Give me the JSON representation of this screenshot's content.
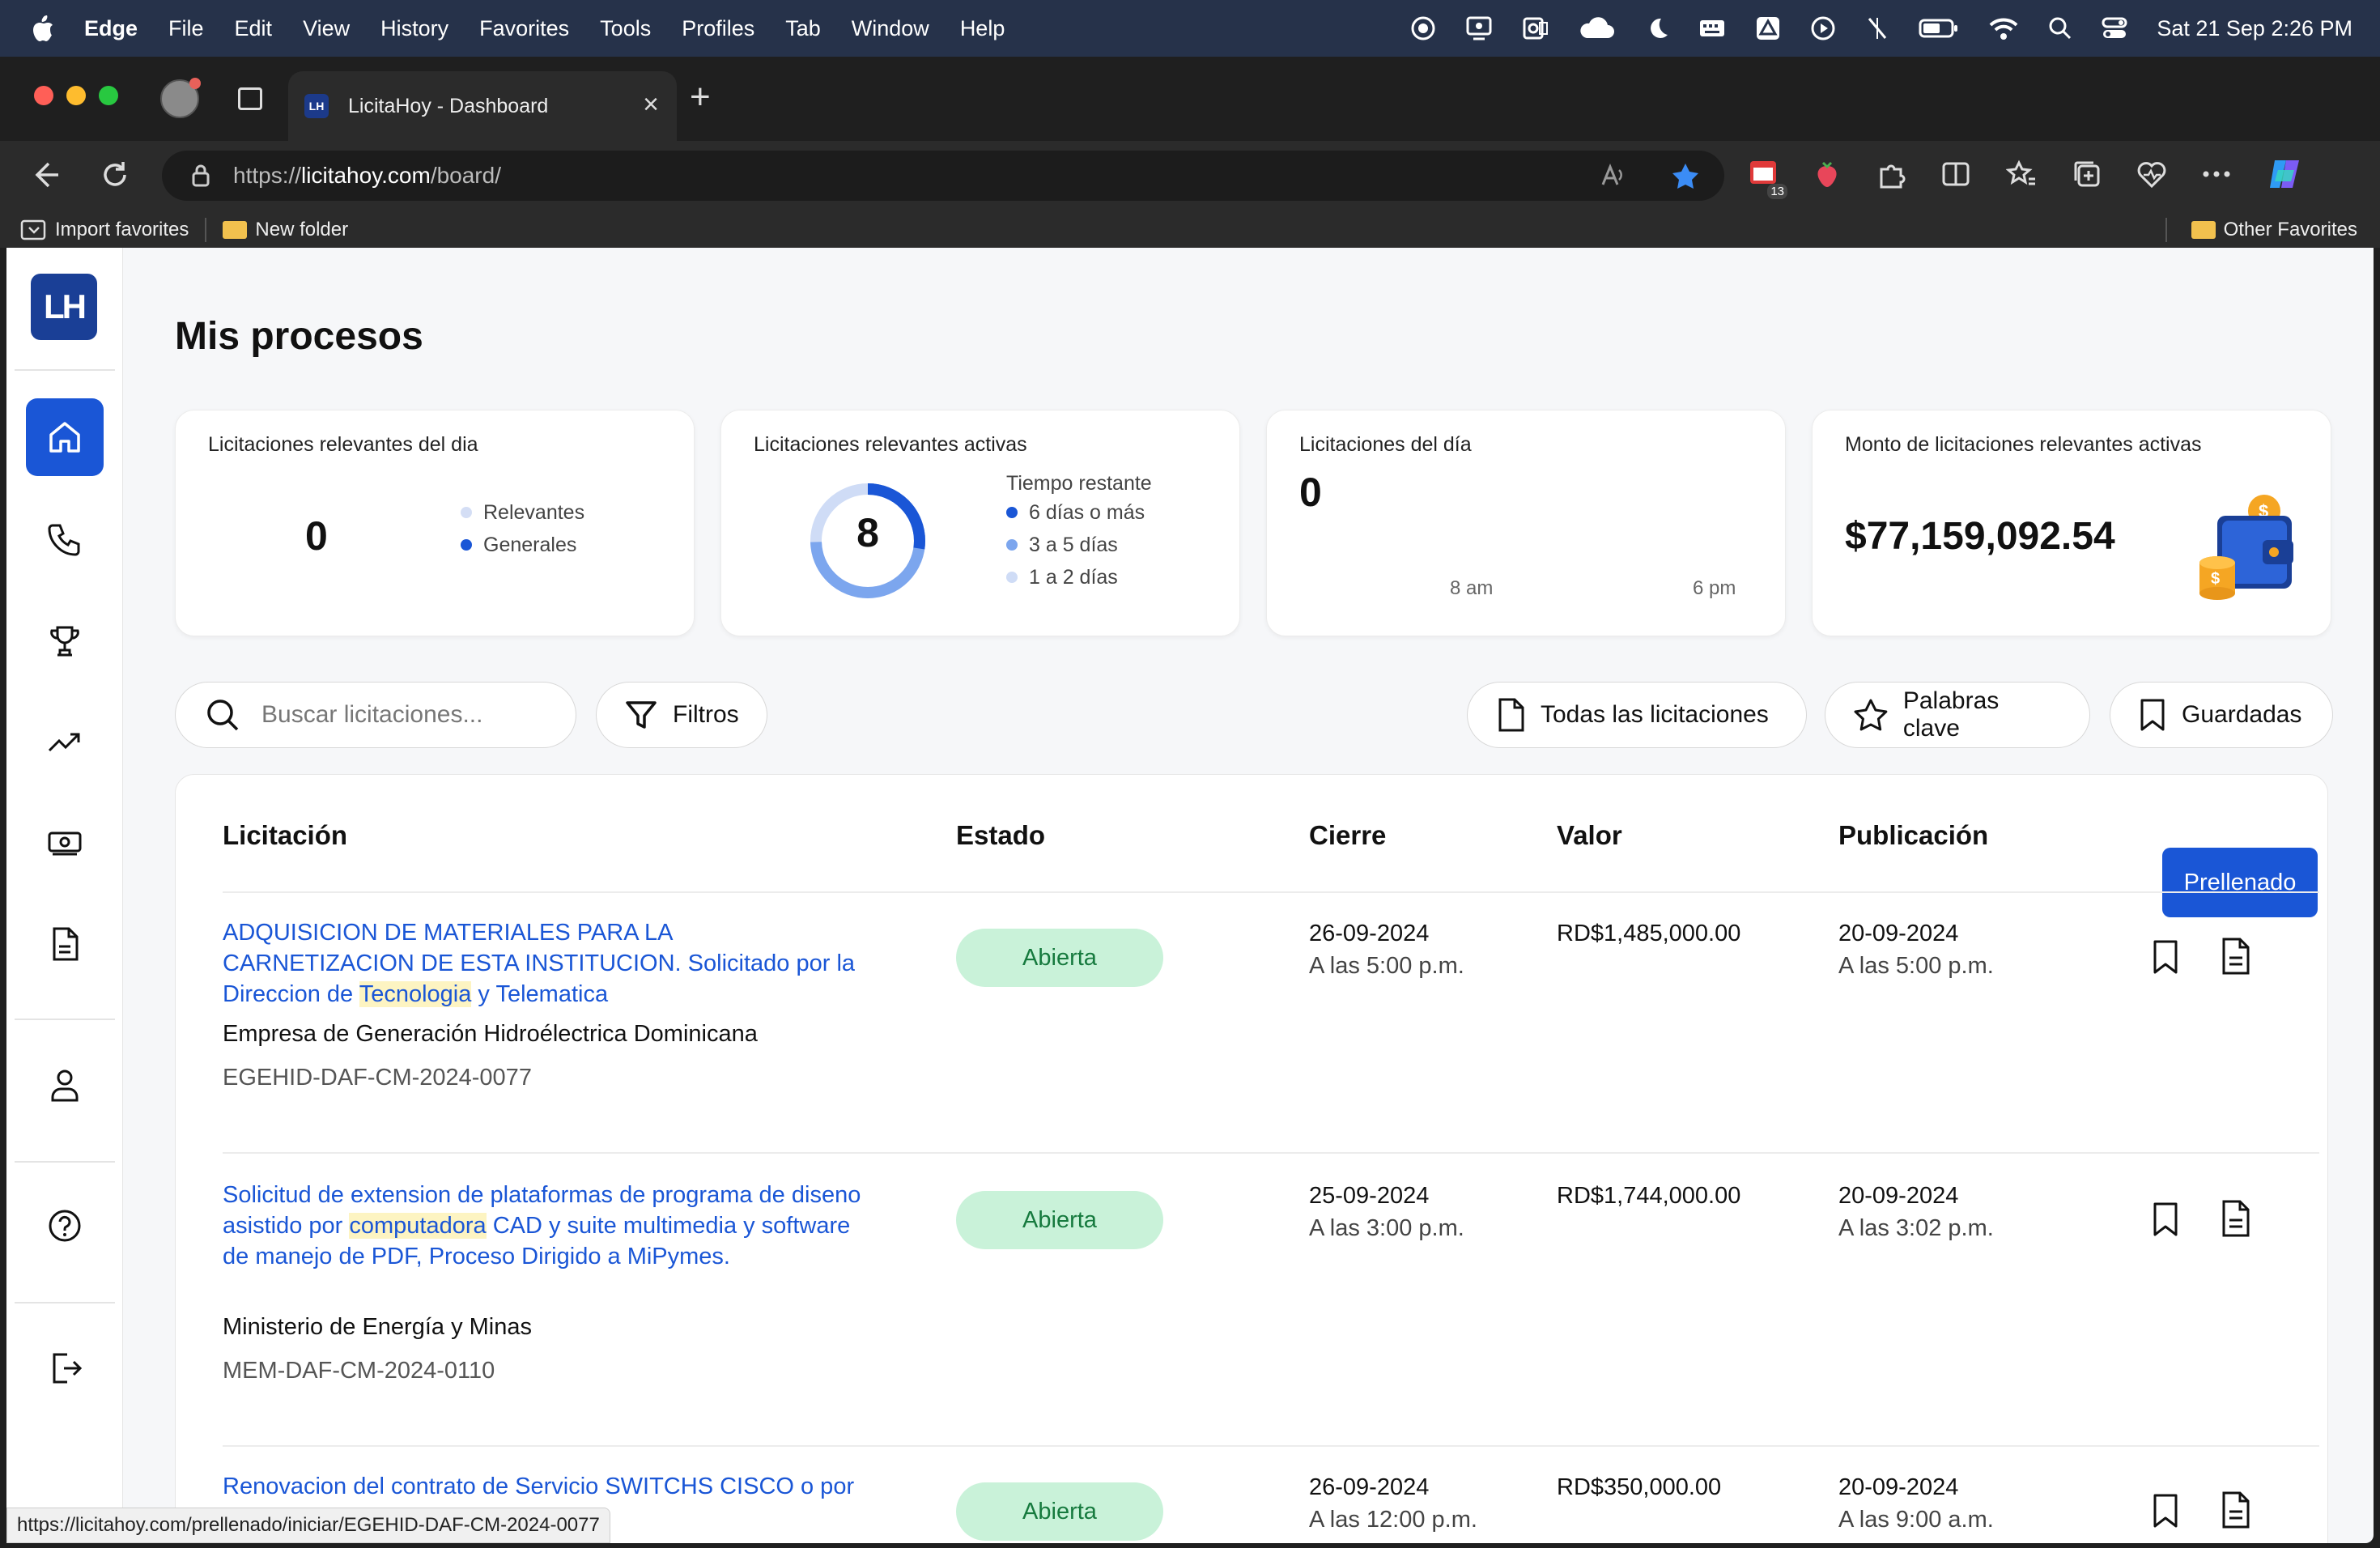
{
  "menubar": {
    "app": "Edge",
    "items": [
      "File",
      "Edit",
      "View",
      "History",
      "Favorites",
      "Tools",
      "Profiles",
      "Tab",
      "Window",
      "Help"
    ],
    "datetime": "Sat 21 Sep  2:26 PM"
  },
  "browser": {
    "tab_title": "LicitaHoy - Dashboard",
    "url_prefix": "https://",
    "url_domain": "licitahoy.com",
    "url_path": "/board/",
    "ext_badge": "13",
    "favorites": {
      "import": "Import favorites",
      "folder": "New folder",
      "other": "Other Favorites"
    },
    "status_url": "https://licitahoy.com/prellenado/iniciar/EGEHID-DAF-CM-2024-0077"
  },
  "app": {
    "logo": "LH",
    "page_title": "Mis procesos",
    "cards": {
      "c1": {
        "title": "Licitaciones relevantes del dia",
        "value": "0",
        "legend": [
          "Relevantes",
          "Generales"
        ]
      },
      "c2": {
        "title": "Licitaciones relevantes activas",
        "value": "8",
        "legend_title": "Tiempo restante",
        "legend": [
          "6 días o más",
          "3 a 5 días",
          "1 a 2 días"
        ]
      },
      "c3": {
        "title": "Licitaciones del día",
        "value": "0",
        "axis_start": "8 am",
        "axis_end": "6 pm"
      },
      "c4": {
        "title": "Monto de licitaciones relevantes activas",
        "value": "$77,159,092.54"
      }
    },
    "search_placeholder": "Buscar licitaciones...",
    "filters_label": "Filtros",
    "view_buttons": {
      "all": "Todas las licitaciones",
      "keywords": "Palabras clave",
      "saved": "Guardadas"
    },
    "table": {
      "headers": [
        "Licitación",
        "Estado",
        "Cierre",
        "Valor",
        "Publicación"
      ],
      "prellenado": "Prellenado",
      "rows": [
        {
          "title_a": "ADQUISICION DE MATERIALES PARA LA CARNETIZACION DE ESTA INSTITUCION. Solicitado por la Direccion de ",
          "title_hl": "Tecnologia",
          "title_b": " y Telematica",
          "entity": "Empresa de Generación Hidroélectrica Dominicana",
          "code": "EGEHID-DAF-CM-2024-0077",
          "status": "Abierta",
          "close_date": "26-09-2024",
          "close_time": "A las 5:00 p.m.",
          "value": "RD$1,485,000.00",
          "pub_date": "20-09-2024",
          "pub_time": "A las 5:00 p.m."
        },
        {
          "title_a": "Solicitud de extension de plataformas de programa de diseno asistido por ",
          "title_hl": "computadora",
          "title_b": " CAD y suite multimedia y software de manejo de PDF, Proceso Dirigido a MiPymes.",
          "entity": "Ministerio de Energía y Minas",
          "code": "MEM-DAF-CM-2024-0110",
          "status": "Abierta",
          "close_date": "25-09-2024",
          "close_time": "A las 3:00 p.m.",
          "value": "RD$1,744,000.00",
          "pub_date": "20-09-2024",
          "pub_time": "A las 3:02 p.m."
        },
        {
          "title_a": "Renovacion del contrato de Servicio SWITCHS CISCO ",
          "title_hl": "",
          "title_b": "o por el",
          "entity": "",
          "code": "",
          "status": "Abierta",
          "close_date": "26-09-2024",
          "close_time": "A las 12:00 p.m.",
          "value": "RD$350,000.00",
          "pub_date": "20-09-2024",
          "pub_time": "A las 9:00 a.m."
        }
      ]
    }
  }
}
